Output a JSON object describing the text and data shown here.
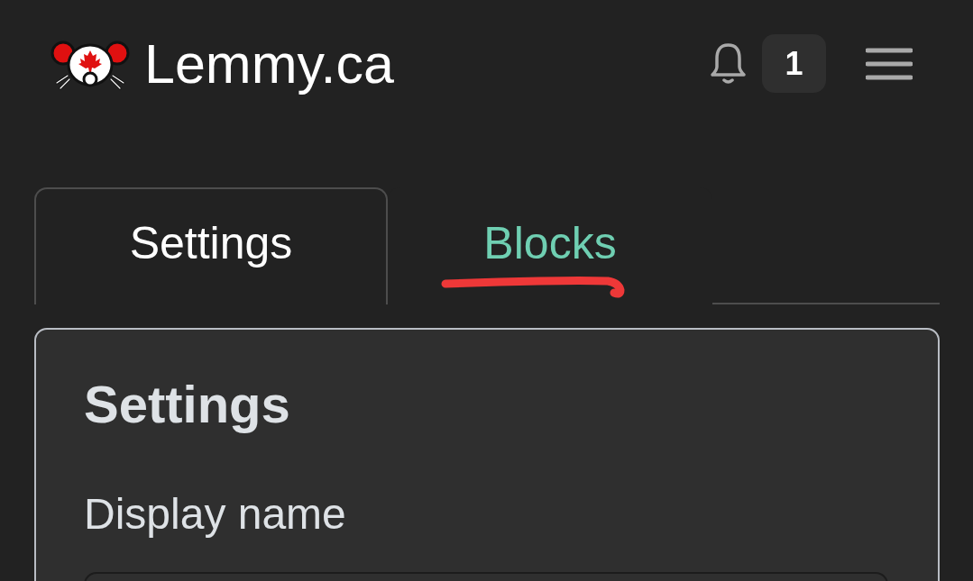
{
  "header": {
    "site_name": "Lemmy.ca",
    "notifications": {
      "count": "1"
    }
  },
  "tabs": [
    {
      "label": "Settings",
      "selected": true
    },
    {
      "label": "Blocks",
      "selected": false
    }
  ],
  "settings_card": {
    "title": "Settings",
    "fields": [
      {
        "label": "Display name"
      }
    ]
  }
}
